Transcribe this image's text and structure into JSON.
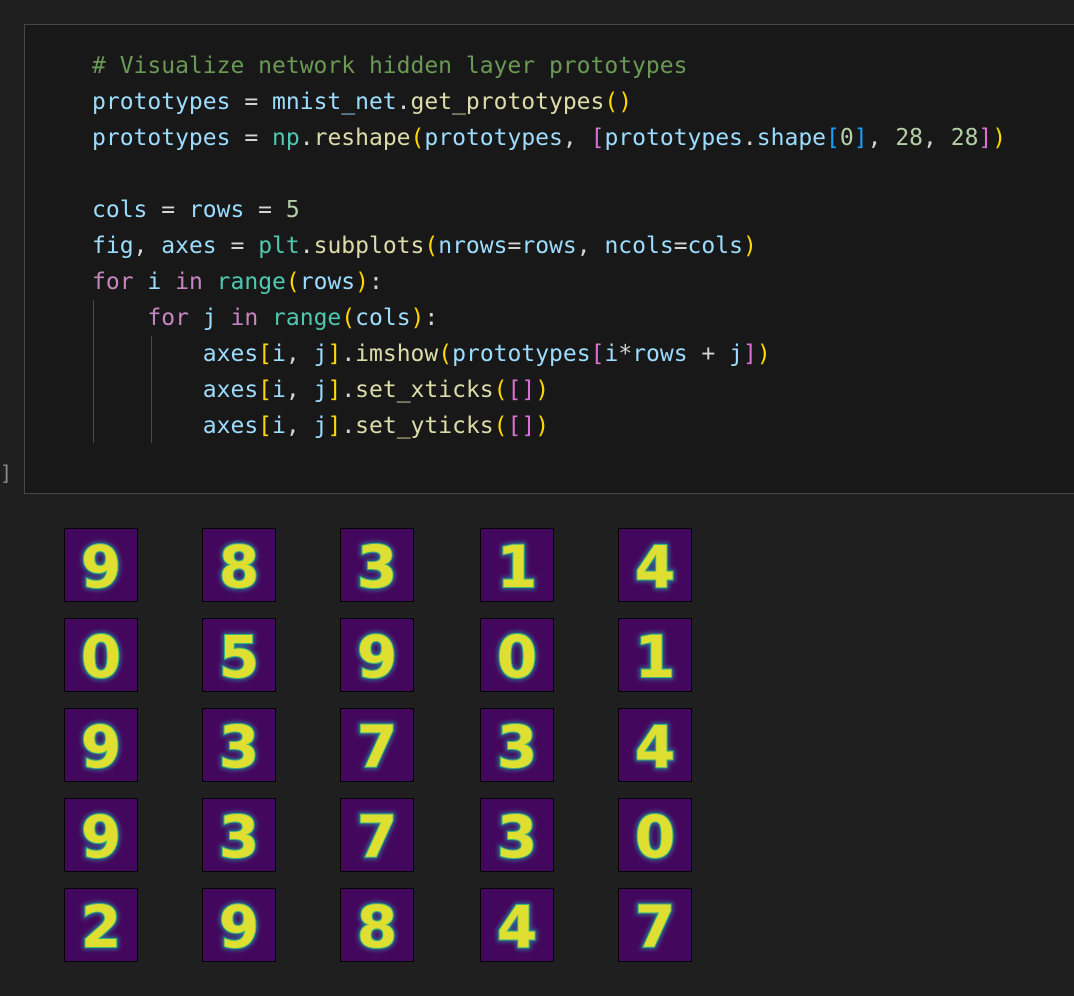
{
  "cell": {
    "execution_bracket": "]",
    "code_lines": [
      [
        {
          "t": "# Visualize network hidden layer prototypes",
          "c": "comment"
        }
      ],
      [
        {
          "t": "prototypes",
          "c": "var"
        },
        {
          "t": " = ",
          "c": "op"
        },
        {
          "t": "mnist_net",
          "c": "var"
        },
        {
          "t": ".",
          "c": "op"
        },
        {
          "t": "get_prototypes",
          "c": "func"
        },
        {
          "t": "()",
          "c": "b1"
        }
      ],
      [
        {
          "t": "prototypes",
          "c": "var"
        },
        {
          "t": " = ",
          "c": "op"
        },
        {
          "t": "np",
          "c": "mod"
        },
        {
          "t": ".",
          "c": "op"
        },
        {
          "t": "reshape",
          "c": "func"
        },
        {
          "t": "(",
          "c": "b1"
        },
        {
          "t": "prototypes",
          "c": "var"
        },
        {
          "t": ", ",
          "c": "op"
        },
        {
          "t": "[",
          "c": "b2"
        },
        {
          "t": "prototypes",
          "c": "var"
        },
        {
          "t": ".",
          "c": "op"
        },
        {
          "t": "shape",
          "c": "var"
        },
        {
          "t": "[",
          "c": "b3"
        },
        {
          "t": "0",
          "c": "num"
        },
        {
          "t": "]",
          "c": "b3"
        },
        {
          "t": ", ",
          "c": "op"
        },
        {
          "t": "28",
          "c": "num"
        },
        {
          "t": ", ",
          "c": "op"
        },
        {
          "t": "28",
          "c": "num"
        },
        {
          "t": "]",
          "c": "b2"
        },
        {
          "t": ")",
          "c": "b1"
        }
      ],
      [],
      [
        {
          "t": "cols",
          "c": "var"
        },
        {
          "t": " = ",
          "c": "op"
        },
        {
          "t": "rows",
          "c": "var"
        },
        {
          "t": " = ",
          "c": "op"
        },
        {
          "t": "5",
          "c": "num"
        }
      ],
      [
        {
          "t": "fig",
          "c": "var"
        },
        {
          "t": ", ",
          "c": "op"
        },
        {
          "t": "axes",
          "c": "var"
        },
        {
          "t": " = ",
          "c": "op"
        },
        {
          "t": "plt",
          "c": "mod"
        },
        {
          "t": ".",
          "c": "op"
        },
        {
          "t": "subplots",
          "c": "func"
        },
        {
          "t": "(",
          "c": "b1"
        },
        {
          "t": "nrows",
          "c": "var"
        },
        {
          "t": "=",
          "c": "op"
        },
        {
          "t": "rows",
          "c": "var"
        },
        {
          "t": ", ",
          "c": "op"
        },
        {
          "t": "ncols",
          "c": "var"
        },
        {
          "t": "=",
          "c": "op"
        },
        {
          "t": "cols",
          "c": "var"
        },
        {
          "t": ")",
          "c": "b1"
        }
      ],
      [
        {
          "t": "for",
          "c": "kw"
        },
        {
          "t": " i ",
          "c": "var"
        },
        {
          "t": "in",
          "c": "kw"
        },
        {
          "t": " ",
          "c": "op"
        },
        {
          "t": "range",
          "c": "builtin"
        },
        {
          "t": "(",
          "c": "b1"
        },
        {
          "t": "rows",
          "c": "var"
        },
        {
          "t": ")",
          "c": "b1"
        },
        {
          "t": ":",
          "c": "op"
        }
      ],
      [
        {
          "t": "    ",
          "c": "op"
        },
        {
          "t": "for",
          "c": "kw"
        },
        {
          "t": " j ",
          "c": "var"
        },
        {
          "t": "in",
          "c": "kw"
        },
        {
          "t": " ",
          "c": "op"
        },
        {
          "t": "range",
          "c": "builtin"
        },
        {
          "t": "(",
          "c": "b1"
        },
        {
          "t": "cols",
          "c": "var"
        },
        {
          "t": ")",
          "c": "b1"
        },
        {
          "t": ":",
          "c": "op"
        }
      ],
      [
        {
          "t": "        ",
          "c": "op"
        },
        {
          "t": "axes",
          "c": "var"
        },
        {
          "t": "[",
          "c": "b1"
        },
        {
          "t": "i",
          "c": "var"
        },
        {
          "t": ", ",
          "c": "op"
        },
        {
          "t": "j",
          "c": "var"
        },
        {
          "t": "]",
          "c": "b1"
        },
        {
          "t": ".",
          "c": "op"
        },
        {
          "t": "imshow",
          "c": "func"
        },
        {
          "t": "(",
          "c": "b1"
        },
        {
          "t": "prototypes",
          "c": "var"
        },
        {
          "t": "[",
          "c": "b2"
        },
        {
          "t": "i",
          "c": "var"
        },
        {
          "t": "*",
          "c": "op"
        },
        {
          "t": "rows",
          "c": "var"
        },
        {
          "t": " + ",
          "c": "op"
        },
        {
          "t": "j",
          "c": "var"
        },
        {
          "t": "]",
          "c": "b2"
        },
        {
          "t": ")",
          "c": "b1"
        }
      ],
      [
        {
          "t": "        ",
          "c": "op"
        },
        {
          "t": "axes",
          "c": "var"
        },
        {
          "t": "[",
          "c": "b1"
        },
        {
          "t": "i",
          "c": "var"
        },
        {
          "t": ", ",
          "c": "op"
        },
        {
          "t": "j",
          "c": "var"
        },
        {
          "t": "]",
          "c": "b1"
        },
        {
          "t": ".",
          "c": "op"
        },
        {
          "t": "set_xticks",
          "c": "func"
        },
        {
          "t": "(",
          "c": "b1"
        },
        {
          "t": "[]",
          "c": "b2"
        },
        {
          "t": ")",
          "c": "b1"
        }
      ],
      [
        {
          "t": "        ",
          "c": "op"
        },
        {
          "t": "axes",
          "c": "var"
        },
        {
          "t": "[",
          "c": "b1"
        },
        {
          "t": "i",
          "c": "var"
        },
        {
          "t": ", ",
          "c": "op"
        },
        {
          "t": "j",
          "c": "var"
        },
        {
          "t": "]",
          "c": "b1"
        },
        {
          "t": ".",
          "c": "op"
        },
        {
          "t": "set_yticks",
          "c": "func"
        },
        {
          "t": "(",
          "c": "b1"
        },
        {
          "t": "[]",
          "c": "b2"
        },
        {
          "t": ")",
          "c": "b1"
        }
      ]
    ]
  },
  "output": {
    "grid_rows": 5,
    "grid_cols": 5,
    "prototype_digits": [
      [
        "9",
        "8",
        "3",
        "1",
        "4"
      ],
      [
        "0",
        "5",
        "9",
        "0",
        "1"
      ],
      [
        "9",
        "3",
        "7",
        "3",
        "4"
      ],
      [
        "9",
        "3",
        "7",
        "3",
        "0"
      ],
      [
        "2",
        "9",
        "8",
        "4",
        "7"
      ]
    ],
    "colormap": {
      "background": "#44075e",
      "low": "#31688e",
      "mid": "#35b779",
      "high": "#fde725"
    }
  }
}
